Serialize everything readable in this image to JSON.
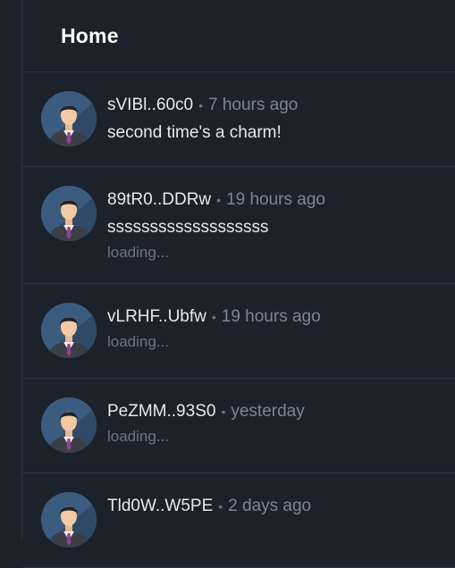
{
  "header": {
    "title": "Home"
  },
  "posts": [
    {
      "author": "sVIBl..60c0",
      "time": "7 hours ago",
      "message": "second time's a charm!",
      "status": ""
    },
    {
      "author": "89tR0..DDRw",
      "time": "19 hours ago",
      "message": "sssssssssssssssssss",
      "status": "loading..."
    },
    {
      "author": "vLRHF..Ubfw",
      "time": "19 hours ago",
      "message": "",
      "status": "loading..."
    },
    {
      "author": "PeZMM..93S0",
      "time": "yesterday",
      "message": "",
      "status": "loading..."
    },
    {
      "author": "Tld0W..W5PE",
      "time": "2 days ago",
      "message": "",
      "status": ""
    }
  ],
  "separator": "•",
  "avatar_icon": "user-avatar-icon",
  "colors": {
    "background": "#1b222c",
    "border": "#2a333f",
    "muted": "#7c8793",
    "avatar_bg": "#3b5c7f"
  }
}
